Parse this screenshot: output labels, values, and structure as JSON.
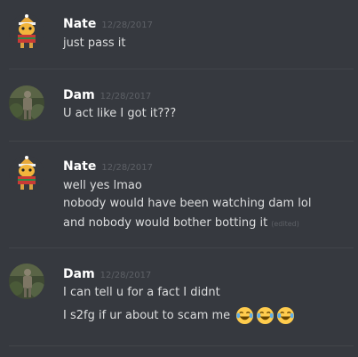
{
  "messages": [
    {
      "username": "Nate",
      "timestamp": "12/28/2017",
      "lines": [
        "just pass it"
      ]
    },
    {
      "username": "Dam",
      "timestamp": "12/28/2017",
      "lines": [
        "U act like I got it???"
      ]
    },
    {
      "username": "Nate",
      "timestamp": "12/28/2017",
      "lines": [
        "well yes lmao",
        "nobody would have been watching dam lol",
        "and nobody would bother botting it"
      ],
      "edited_label": "(edited)"
    },
    {
      "username": "Dam",
      "timestamp": "12/28/2017",
      "lines": [
        "I can tell u for a fact I didnt",
        "I s2fg if ur about to scam me"
      ],
      "emojis": [
        "joy-emoji",
        "joy-emoji",
        "joy-emoji"
      ]
    }
  ],
  "colors": {
    "background": "#36393f",
    "username": "#ffffff",
    "timestamp": "#5d6066",
    "text": "#dcddde",
    "divider": "#42454a"
  }
}
